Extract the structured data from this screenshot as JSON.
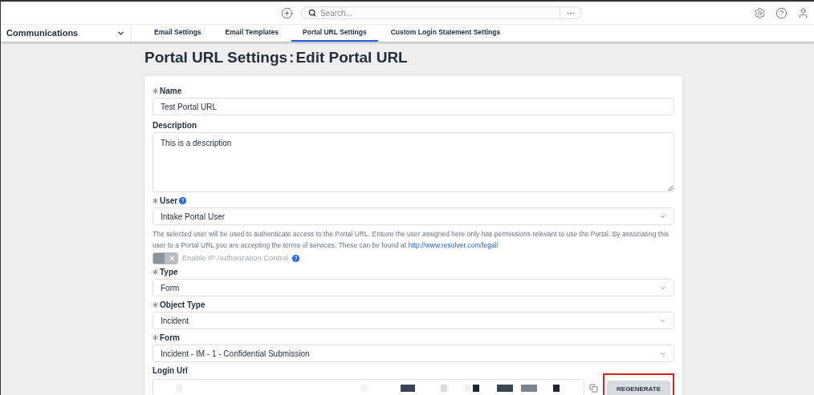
{
  "topbar": {
    "search": {
      "placeholder": "Search..."
    }
  },
  "nav": {
    "section": "Communications",
    "tabs": [
      {
        "label": "Email Settings",
        "selected": false
      },
      {
        "label": "Email Templates",
        "selected": false
      },
      {
        "label": "Portal URL Settings",
        "selected": true
      },
      {
        "label": "Custom Login Statement Settings",
        "selected": false
      }
    ]
  },
  "page": {
    "title": "Portal URL Settings",
    "separator": ":",
    "subtitle": "Edit Portal URL"
  },
  "form": [
    {
      "kind": "text",
      "label": "Name",
      "required": true,
      "value": "Test Portal URL"
    },
    {
      "kind": "textarea",
      "label": "Description",
      "required": false,
      "value": "This is a description"
    },
    {
      "kind": "select",
      "label": "User",
      "required": true,
      "help_icon": true,
      "value": "Intake Portal User"
    },
    {
      "kind": "note",
      "text": "The selected user will be used to authenticate access to the Portal URL. Ensure the user assigned here only has permissions relevant to use the Portal. By associating this user to a Portal URL you are accepting the terms of services. These can be found at",
      "link": "http://www.resolver.com/legal/"
    },
    {
      "kind": "toggle",
      "label": "Enable IP Authorization Control",
      "on": false,
      "disabled": true,
      "help_icon": true
    },
    {
      "kind": "select",
      "label": "Type",
      "required": true,
      "value": "Form"
    },
    {
      "kind": "select",
      "label": "Object Type",
      "required": true,
      "value": "Incident"
    },
    {
      "kind": "select",
      "label": "Form",
      "required": true,
      "value": "Incident - IM - 1 - Confidential Submission"
    },
    {
      "kind": "url",
      "label": "Login Url",
      "required": false,
      "button": "REGENERATE",
      "highlighted": true
    }
  ]
}
